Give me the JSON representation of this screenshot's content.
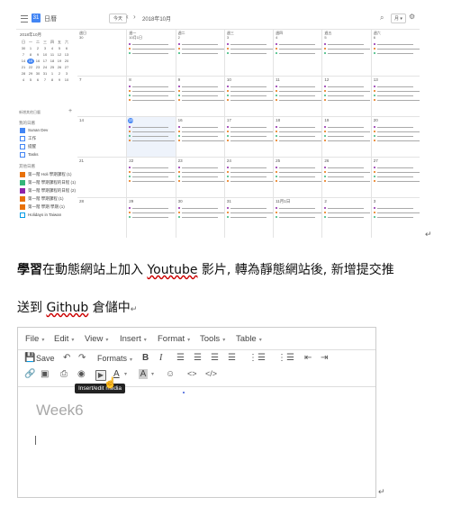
{
  "calendar": {
    "title": "日曆",
    "today_button": "今天",
    "month": "2018年10月",
    "view_button": "月 ▾",
    "mini_month": "2018年10月",
    "mini_weekdays": [
      "日",
      "一",
      "二",
      "三",
      "四",
      "五",
      "六"
    ],
    "mini_days": [
      "30",
      "1",
      "2",
      "3",
      "4",
      "5",
      "6",
      "7",
      "8",
      "9",
      "10",
      "11",
      "12",
      "13",
      "14",
      "15",
      "16",
      "17",
      "18",
      "19",
      "20",
      "21",
      "22",
      "23",
      "24",
      "25",
      "26",
      "27",
      "28",
      "29",
      "30",
      "31",
      "1",
      "2",
      "3",
      "4",
      "5",
      "6",
      "7",
      "8",
      "9",
      "10"
    ],
    "mini_today_index": 15,
    "search_people": "新增其他日曆",
    "my_calendars_label": "我的日曆",
    "my_calendars": [
      "Sunan Dev",
      "工作",
      "提醒",
      "Tasks"
    ],
    "other_calendars_label": "其他日曆",
    "other_calendars": [
      "第一階 Holi 學期課程 (1)",
      "第一階 學期課程的日程 (1)",
      "第一階 學期課程的日程 (2)",
      "第一階 學期課程 (1)",
      "第一階 學期 學期 (1)",
      "Holidays in Taiwan"
    ],
    "weekdays": [
      "週日",
      "週一",
      "週二",
      "週三",
      "週四",
      "週五",
      "週六"
    ],
    "header_dates": [
      "30",
      "10月1日",
      "2",
      "3",
      "4",
      "5",
      "6"
    ],
    "weeks": [
      [
        "7",
        "8",
        "9",
        "10",
        "11",
        "12",
        "13"
      ],
      [
        "14",
        "15",
        "16",
        "17",
        "18",
        "19",
        "20"
      ],
      [
        "21",
        "22",
        "23",
        "24",
        "25",
        "26",
        "27"
      ],
      [
        "28",
        "29",
        "30",
        "31",
        "11月1日",
        "2",
        "3"
      ]
    ],
    "today_label": "15"
  },
  "document": {
    "line1_bold": "學習",
    "line1_a": "在動態網站上加入 ",
    "line1_youtube": "Youtube",
    "line1_b": " 影片, 轉為靜態網站後, 新增提交推",
    "line2_a": "送到 ",
    "line2_github": "Github",
    "line2_b": " 倉儲中",
    "para_mark": "↵"
  },
  "editor": {
    "menus": [
      "File",
      "Edit",
      "View",
      "Insert",
      "Format",
      "Tools",
      "Table"
    ],
    "save_label": "Save",
    "formats_label": "Formats",
    "tooltip": "Insert/edit media",
    "title_text": "Week6",
    "colors": {
      "tooltip_bg": "#222222",
      "title": "#a8a8a8"
    }
  },
  "colors": {
    "accent": "#4285f4",
    "event_purple": "#8e24aa",
    "event_orange": "#e8710a",
    "event_green": "#33b679"
  }
}
